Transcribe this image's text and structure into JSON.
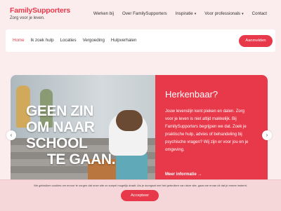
{
  "logo": {
    "brand": "FamilySupporters",
    "tagline": "Zorg voor je leven."
  },
  "topnav": [
    {
      "label": "Werken bij"
    },
    {
      "label": "Over FamilySupporters"
    },
    {
      "label": "Inspiratie",
      "dropdown": true
    },
    {
      "label": "Voor professionals",
      "dropdown": true
    },
    {
      "label": "Contact"
    }
  ],
  "mainnav": [
    {
      "label": "Home"
    },
    {
      "label": "Ik zoek hulp"
    },
    {
      "label": "Locaties"
    },
    {
      "label": "Vergoeding"
    },
    {
      "label": "Hulpverhalen"
    }
  ],
  "login_label": "Aanmelden",
  "hero": {
    "slogan": [
      "GEEN ZIN",
      "OM NAAR",
      "SCHOOL",
      "TE GAAN."
    ],
    "title": "Herkenbaar?",
    "body": "Jouw levenslijn kent pieken en dalen. Zorg voor je leven is niet altijd makkelijk. Bij FamilySupporters begrijpen we dat. Zoek je praktische hulp, advies of behandeling bij psychische vragen? Wij zijn er voor jou en je omgeving.",
    "more": "Meer informatie",
    "more_icon": "arrow-right-icon"
  },
  "cookie": {
    "text": "We gebruiken cookies om ervoor te zorgen dat onze site zo soepel mogelijk draait. Als je doorgaat met het gebruiken van deze site, gaan we ervan uit dat je ermee instemt.",
    "accept": "Accepteer"
  },
  "colors": {
    "accent": "#e8394a",
    "background": "#fbeced"
  }
}
